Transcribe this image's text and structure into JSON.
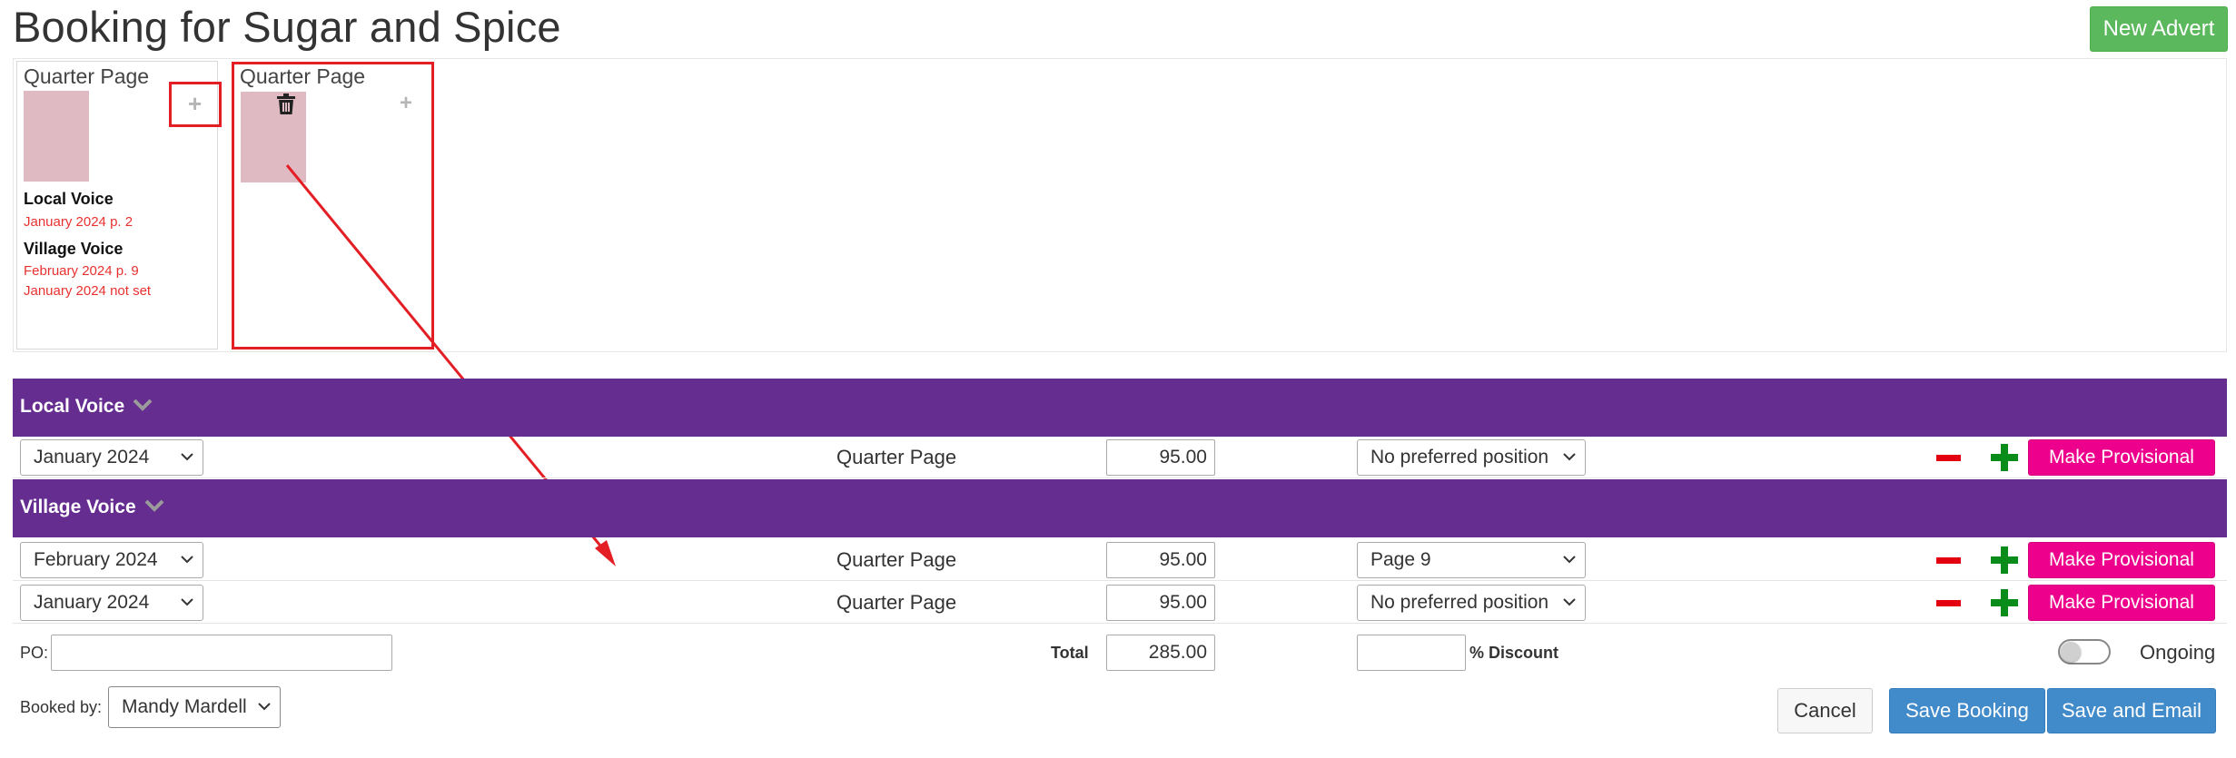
{
  "page": {
    "title": "Booking for Sugar and Spice",
    "new_advert_label": "New Advert"
  },
  "adverts": [
    {
      "title": "Quarter Page",
      "publications": [
        {
          "name": "Local Voice",
          "issues": [
            "January 2024 p. 2"
          ]
        },
        {
          "name": "Village Voice",
          "issues": [
            "February 2024 p. 9",
            "January 2024 not set"
          ]
        }
      ]
    },
    {
      "title": "Quarter Page",
      "publications": []
    }
  ],
  "sections": [
    {
      "name": "Local Voice",
      "rows": [
        {
          "issue": "January 2024",
          "size": "Quarter Page",
          "price": "95.00",
          "position": "No preferred position",
          "action": "Make Provisional"
        }
      ]
    },
    {
      "name": "Village Voice",
      "rows": [
        {
          "issue": "February 2024",
          "size": "Quarter Page",
          "price": "95.00",
          "position": "Page 9",
          "action": "Make Provisional"
        },
        {
          "issue": "January 2024",
          "size": "Quarter Page",
          "price": "95.00",
          "position": "No preferred position",
          "action": "Make Provisional"
        }
      ]
    }
  ],
  "footer": {
    "po_label": "PO:",
    "po_value": "",
    "total_label": "Total",
    "total_value": "285.00",
    "discount_value": "",
    "discount_label": "% Discount",
    "ongoing_label": "Ongoing",
    "ongoing_on": false,
    "booked_by_label": "Booked by:",
    "booked_by_value": "Mandy Mardell",
    "cancel_label": "Cancel",
    "save_label": "Save Booking",
    "save_email_label": "Save and Email"
  },
  "colors": {
    "section_bar": "#662d91",
    "provisional_button": "#ec008c",
    "primary_button": "#428bca",
    "new_advert_button": "#5cb85c",
    "annotation": "#e41e25"
  },
  "icons": [
    "plus-icon",
    "trash-icon",
    "chevron-down-icon",
    "caret-down-icon",
    "minus-icon",
    "green-plus-icon"
  ]
}
